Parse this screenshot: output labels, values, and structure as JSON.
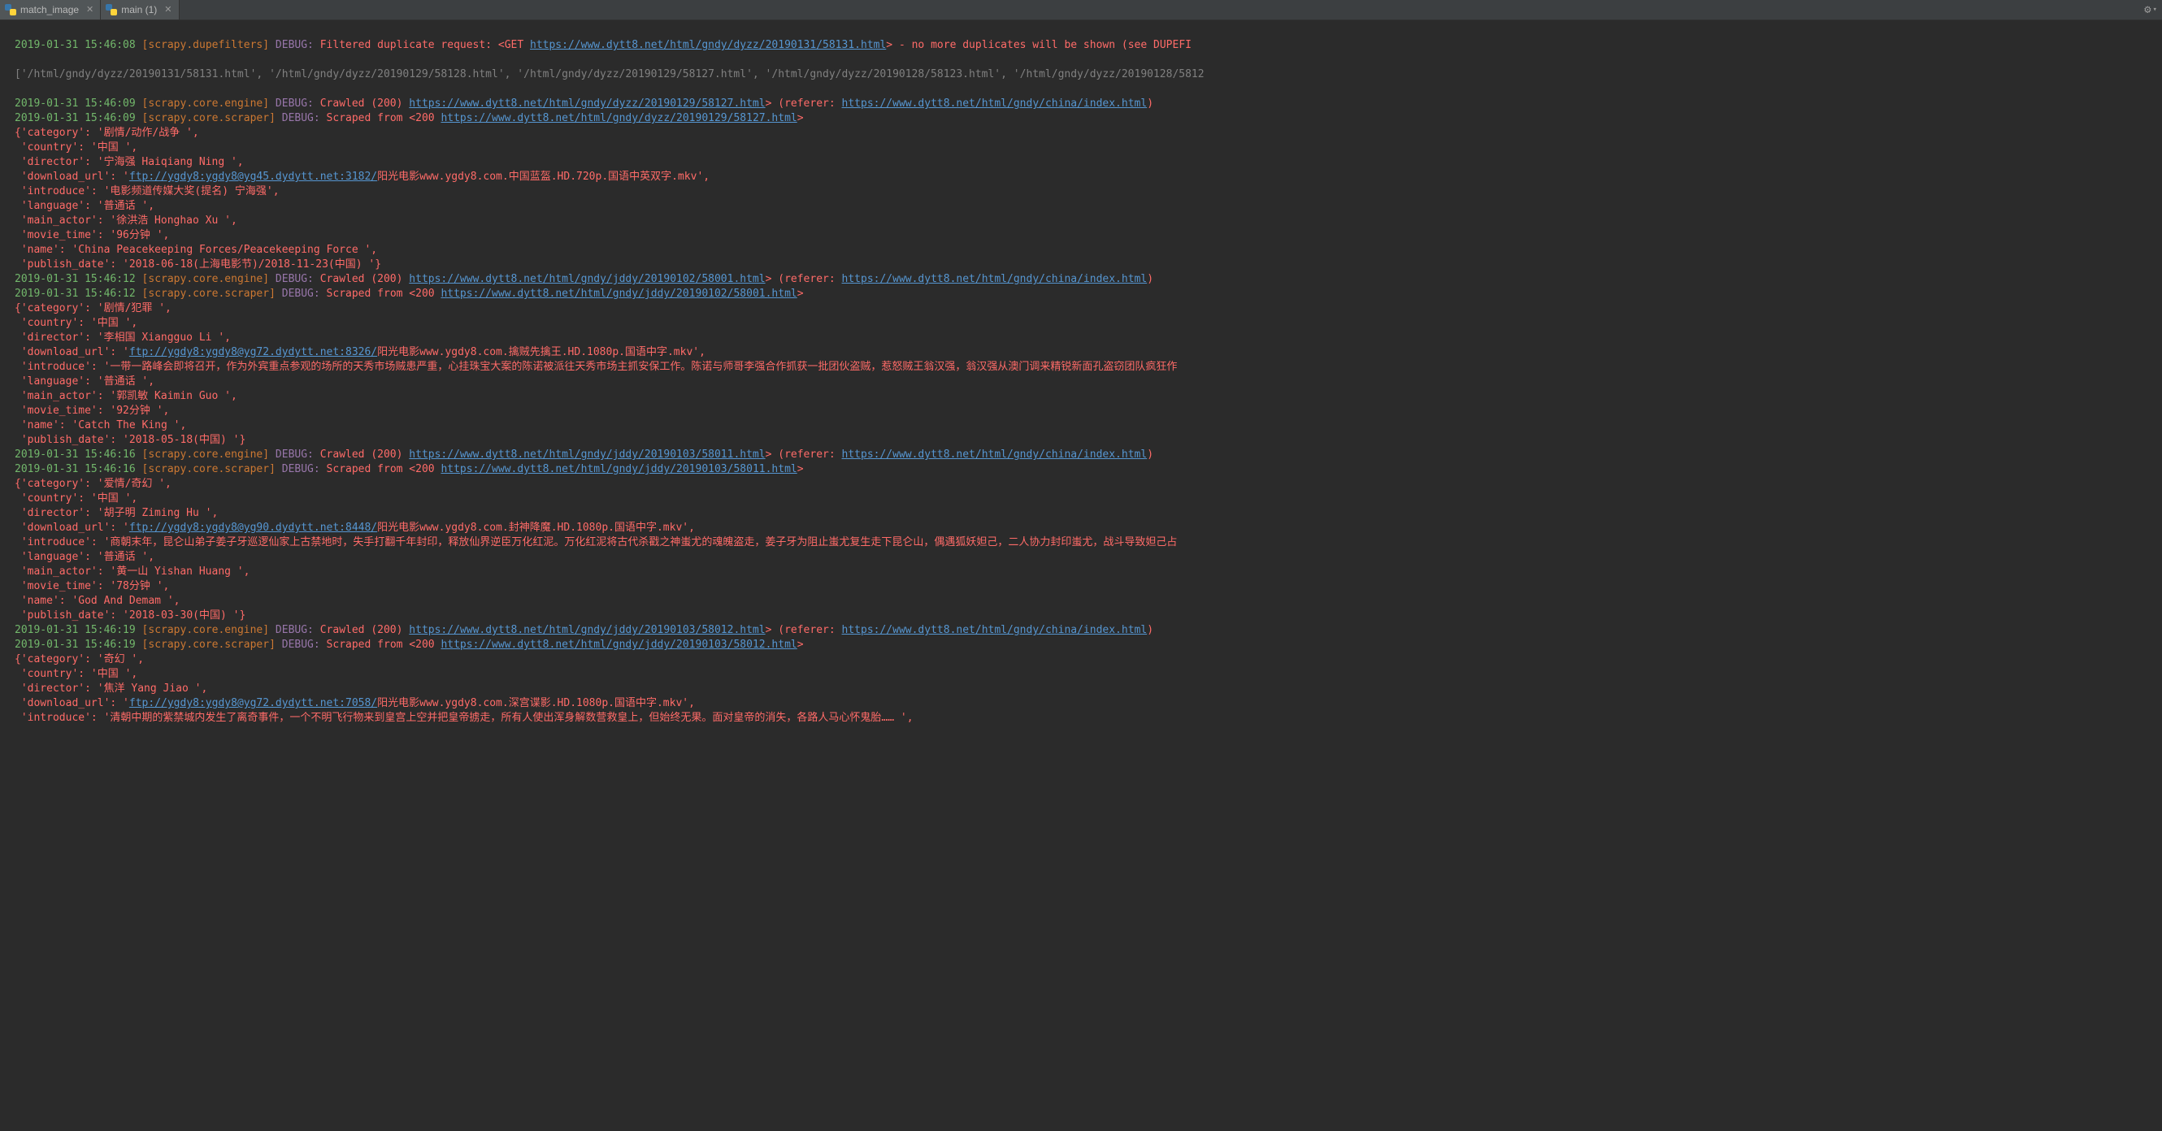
{
  "tabs": [
    {
      "label": "match_image"
    },
    {
      "label": "main (1)"
    }
  ],
  "truncated_top": {
    "ts": "2019-01-31 15:46:08",
    "mod": "[scrapy.dupefilters]",
    "dbg": "DEBUG:",
    "msg": "Filtered duplicate request: <GET ",
    "url": "https://www.dytt8.net/html/gndy/dyzz/20190131/58131.html",
    "tail": "> - no more duplicates will be shown (see DUPEFI"
  },
  "paths_line": "['/html/gndy/dyzz/20190131/58131.html', '/html/gndy/dyzz/20190129/58128.html', '/html/gndy/dyzz/20190129/58127.html', '/html/gndy/dyzz/20190128/58123.html', '/html/gndy/dyzz/20190128/5812",
  "referer_url": "https://www.dytt8.net/html/gndy/china/index.html",
  "blocks": [
    {
      "crawl_ts": "2019-01-31 15:46:09",
      "crawl_mod": "[scrapy.core.engine]",
      "crawl_dbg": "DEBUG:",
      "crawl_text": "Crawled (200) <GET ",
      "crawl_url": "https://www.dytt8.net/html/gndy/dyzz/20190129/58127.html",
      "scrape_ts": "2019-01-31 15:46:09",
      "scrape_mod": "[scrapy.core.scraper]",
      "scrape_dbg": "DEBUG:",
      "scrape_text": "Scraped from <200 ",
      "scrape_url": "https://www.dytt8.net/html/gndy/dyzz/20190129/58127.html",
      "item": {
        "category": "{'category': '剧情/动作/战争 ',",
        "country": " 'country': '中国 ',",
        "director": " 'director': '宁海强 Haiqiang Ning ',",
        "dl_pre": " 'download_url': '",
        "dl_url": "ftp://ygdy8:ygdy8@yg45.dydytt.net:3182/",
        "dl_suf": "阳光电影www.ygdy8.com.中国蓝盔.HD.720p.国语中英双字.mkv',",
        "introduce": " 'introduce': '电影频道传媒大奖(提名) 宁海强',",
        "language": " 'language': '普通话 ',",
        "main_actor": " 'main_actor': '徐洪浩 Honghao Xu ',",
        "movie_time": " 'movie_time': '96分钟 ',",
        "name": " 'name': 'China Peacekeeping Forces/Peacekeeping Force ',",
        "publish_date": " 'publish_date': '2018-06-18(上海电影节)/2018-11-23(中国) '}"
      }
    },
    {
      "crawl_ts": "2019-01-31 15:46:12",
      "crawl_mod": "[scrapy.core.engine]",
      "crawl_dbg": "DEBUG:",
      "crawl_text": "Crawled (200) <GET ",
      "crawl_url": "https://www.dytt8.net/html/gndy/jddy/20190102/58001.html",
      "scrape_ts": "2019-01-31 15:46:12",
      "scrape_mod": "[scrapy.core.scraper]",
      "scrape_dbg": "DEBUG:",
      "scrape_text": "Scraped from <200 ",
      "scrape_url": "https://www.dytt8.net/html/gndy/jddy/20190102/58001.html",
      "item": {
        "category": "{'category': '剧情/犯罪 ',",
        "country": " 'country': '中国 ',",
        "director": " 'director': '李相国 Xiangguo Li ',",
        "dl_pre": " 'download_url': '",
        "dl_url": "ftp://ygdy8:ygdy8@yg72.dydytt.net:8326/",
        "dl_suf": "阳光电影www.ygdy8.com.擒贼先擒王.HD.1080p.国语中字.mkv',",
        "introduce": " 'introduce': '一带一路峰会即将召开，作为外宾重点参观的场所的天秀市场贼患严重，心挂珠宝大案的陈诺被派往天秀市场主抓安保工作。陈诺与师哥李强合作抓获一批团伙盗贼，惹怒贼王翁汉强，翁汉强从澳门调来精锐新面孔盗窃团队疯狂作",
        "language": " 'language': '普通话 ',",
        "main_actor": " 'main_actor': '郭凯敏 Kaimin Guo ',",
        "movie_time": " 'movie_time': '92分钟 ',",
        "name": " 'name': 'Catch The King ',",
        "publish_date": " 'publish_date': '2018-05-18(中国) '}"
      }
    },
    {
      "crawl_ts": "2019-01-31 15:46:16",
      "crawl_mod": "[scrapy.core.engine]",
      "crawl_dbg": "DEBUG:",
      "crawl_text": "Crawled (200) <GET ",
      "crawl_url": "https://www.dytt8.net/html/gndy/jddy/20190103/58011.html",
      "scrape_ts": "2019-01-31 15:46:16",
      "scrape_mod": "[scrapy.core.scraper]",
      "scrape_dbg": "DEBUG:",
      "scrape_text": "Scraped from <200 ",
      "scrape_url": "https://www.dytt8.net/html/gndy/jddy/20190103/58011.html",
      "item": {
        "category": "{'category': '爱情/奇幻 ',",
        "country": " 'country': '中国 ',",
        "director": " 'director': '胡子明 Ziming Hu ',",
        "dl_pre": " 'download_url': '",
        "dl_url": "ftp://ygdy8:ygdy8@yg90.dydytt.net:8448/",
        "dl_suf": "阳光电影www.ygdy8.com.封神降魔.HD.1080p.国语中字.mkv',",
        "introduce": " 'introduce': '商朝末年，昆仑山弟子姜子牙巡逻仙家上古禁地时，失手打翻千年封印，释放仙界逆臣万化红泥。万化红泥将古代杀戳之神蚩尤的魂魄盗走，姜子牙为阻止蚩尤复生走下昆仑山，偶遇狐妖妲己，二人协力封印蚩尤，战斗导致妲己占",
        "language": " 'language': '普通话 ',",
        "main_actor": " 'main_actor': '黄一山 Yishan Huang ',",
        "movie_time": " 'movie_time': '78分钟 ',",
        "name": " 'name': 'God And Demam ',",
        "publish_date": " 'publish_date': '2018-03-30(中国) '}"
      }
    },
    {
      "crawl_ts": "2019-01-31 15:46:19",
      "crawl_mod": "[scrapy.core.engine]",
      "crawl_dbg": "DEBUG:",
      "crawl_text": "Crawled (200) <GET ",
      "crawl_url": "https://www.dytt8.net/html/gndy/jddy/20190103/58012.html",
      "scrape_ts": "2019-01-31 15:46:19",
      "scrape_mod": "[scrapy.core.scraper]",
      "scrape_dbg": "DEBUG:",
      "scrape_text": "Scraped from <200 ",
      "scrape_url": "https://www.dytt8.net/html/gndy/jddy/20190103/58012.html",
      "item": {
        "category": "{'category': '奇幻 ',",
        "country": " 'country': '中国 ',",
        "director": " 'director': '焦洋 Yang Jiao ',",
        "dl_pre": " 'download_url': '",
        "dl_url": "ftp://ygdy8:ygdy8@yg72.dydytt.net:7058/",
        "dl_suf": "阳光电影www.ygdy8.com.深宫谍影.HD.1080p.国语中字.mkv',",
        "introduce": " 'introduce': '清朝中期的紫禁城内发生了离奇事件，一个不明飞行物来到皇宫上空并把皇帝掳走，所有人使出浑身解数营救皇上，但始终无果。面对皇帝的消失，各路人马心怀鬼胎…… ',"
      }
    }
  ]
}
